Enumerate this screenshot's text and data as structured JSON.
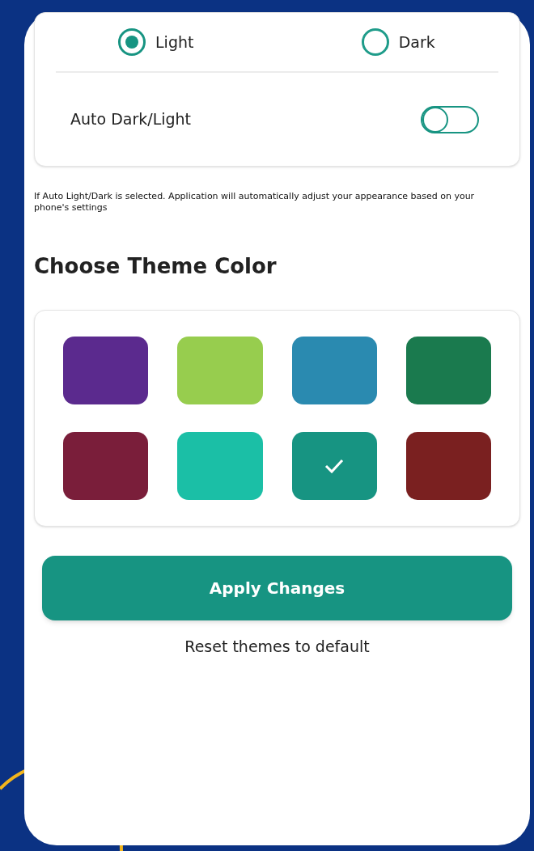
{
  "appearance": {
    "modes": [
      {
        "label": "Light",
        "selected": true
      },
      {
        "label": "Dark",
        "selected": false
      }
    ],
    "auto": {
      "label": "Auto Dark/Light",
      "on": false
    }
  },
  "note": "If Auto Light/Dark is selected. Application will automatically adjust your appearance based on your phone's settings",
  "theme": {
    "heading": "Choose Theme Color",
    "swatches": [
      {
        "color": "#5b2a8e",
        "selected": false
      },
      {
        "color": "#97cd4e",
        "selected": false
      },
      {
        "color": "#2a8ab0",
        "selected": false
      },
      {
        "color": "#1a7a4e",
        "selected": false
      },
      {
        "color": "#7a1e3a",
        "selected": false
      },
      {
        "color": "#1bbfa6",
        "selected": false
      },
      {
        "color": "#179482",
        "selected": true
      },
      {
        "color": "#7a2020",
        "selected": false
      }
    ]
  },
  "apply_button": "Apply Changes",
  "reset_link": "Reset themes to default"
}
